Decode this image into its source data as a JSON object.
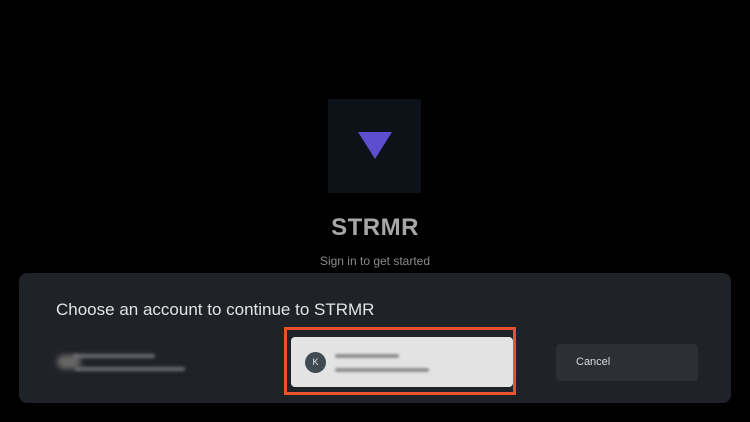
{
  "app": {
    "name": "STRMR",
    "tagline": "Sign in to get started",
    "logo_icon": "purple-down-triangle",
    "logo_color": "#5b4fcf"
  },
  "chooser": {
    "title": "Choose an account to continue to STRMR",
    "accounts": [
      {
        "avatar_initial": "",
        "selected": false,
        "blurred": true
      },
      {
        "avatar_initial": "K",
        "selected": true,
        "blurred": true
      }
    ],
    "cancel_label": "Cancel"
  },
  "colors": {
    "background": "#000000",
    "sheet": "#1f2227",
    "focus_ring": "#e8532d",
    "selected_card": "#e3e3e3"
  }
}
